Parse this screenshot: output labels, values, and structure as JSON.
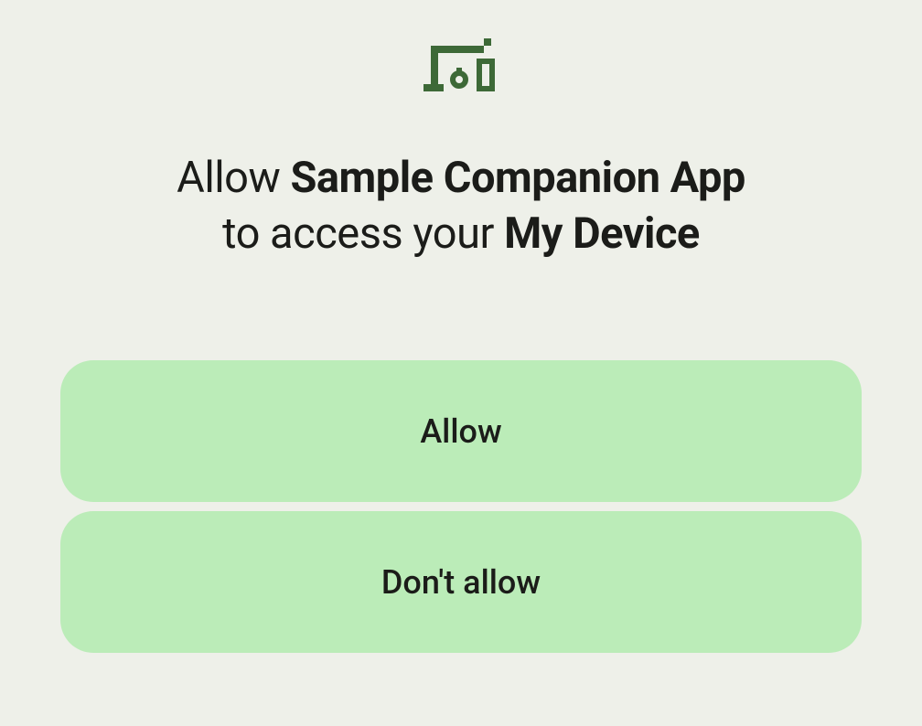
{
  "dialog": {
    "title_parts": {
      "pre": "Allow ",
      "app_name": "Sample Companion App",
      "mid": " to access your ",
      "device_name": "My Device"
    },
    "allow_label": "Allow",
    "deny_label": "Don't allow"
  },
  "icon_color": "#3d6937"
}
